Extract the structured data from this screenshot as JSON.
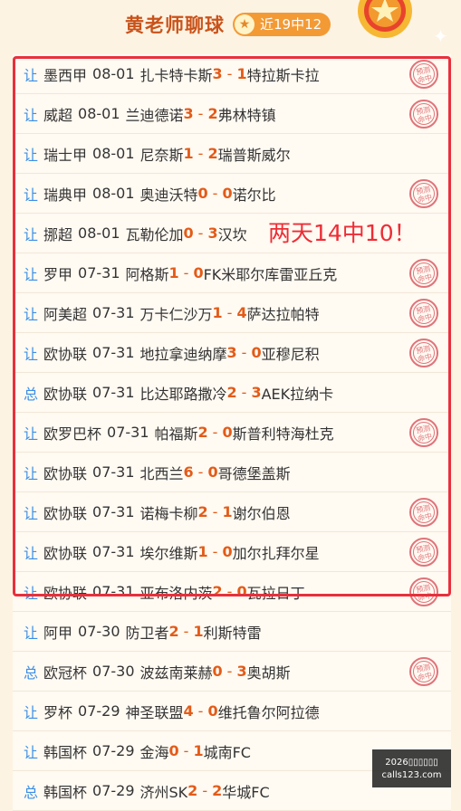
{
  "header": {
    "title": "黄老师聊球",
    "record": "近19中12"
  },
  "annotation": "两天14中10！",
  "stamp_text": "预测命中",
  "matches": [
    {
      "type": "让",
      "league": "墨西甲",
      "date": "08-01",
      "home": "扎卡特卡斯",
      "home_score": "3",
      "away_score": "1",
      "away": "特拉斯卡拉",
      "hit": true
    },
    {
      "type": "让",
      "league": "威超",
      "date": "08-01",
      "home": "兰迪德诺",
      "home_score": "3",
      "away_score": "2",
      "away": "弗林特镇",
      "hit": true
    },
    {
      "type": "让",
      "league": "瑞士甲",
      "date": "08-01",
      "home": "尼奈斯",
      "home_score": "1",
      "away_score": "2",
      "away": "瑞普斯威尔",
      "hit": false
    },
    {
      "type": "让",
      "league": "瑞典甲",
      "date": "08-01",
      "home": "奥迪沃特",
      "home_score": "0",
      "away_score": "0",
      "away": "诺尔比",
      "hit": true
    },
    {
      "type": "让",
      "league": "挪超",
      "date": "08-01",
      "home": "瓦勒伦加",
      "home_score": "0",
      "away_score": "3",
      "away": "汉坎",
      "hit": false
    },
    {
      "type": "让",
      "league": "罗甲",
      "date": "07-31",
      "home": "阿格斯",
      "home_score": "1",
      "away_score": "0",
      "away": "FK米耶尔库雷亚丘克",
      "hit": true
    },
    {
      "type": "让",
      "league": "阿美超",
      "date": "07-31",
      "home": "万卡仁沙万",
      "home_score": "1",
      "away_score": "4",
      "away": "萨达拉帕特",
      "hit": true
    },
    {
      "type": "让",
      "league": "欧协联",
      "date": "07-31",
      "home": "地拉拿迪纳摩",
      "home_score": "3",
      "away_score": "0",
      "away": "亚穆尼积",
      "hit": true
    },
    {
      "type": "总",
      "league": "欧协联",
      "date": "07-31",
      "home": "比达耶路撒冷",
      "home_score": "2",
      "away_score": "3",
      "away": "AEK拉纳卡",
      "hit": false
    },
    {
      "type": "让",
      "league": "欧罗巴杯",
      "date": "07-31",
      "home": "帕福斯",
      "home_score": "2",
      "away_score": "0",
      "away": "斯普利特海杜克",
      "hit": true
    },
    {
      "type": "让",
      "league": "欧协联",
      "date": "07-31",
      "home": "北西兰",
      "home_score": "6",
      "away_score": "0",
      "away": "哥德堡盖斯",
      "hit": false
    },
    {
      "type": "让",
      "league": "欧协联",
      "date": "07-31",
      "home": "诺梅卡柳",
      "home_score": "2",
      "away_score": "1",
      "away": "谢尔伯恩",
      "hit": true
    },
    {
      "type": "让",
      "league": "欧协联",
      "date": "07-31",
      "home": "埃尔维斯",
      "home_score": "1",
      "away_score": "0",
      "away": "加尔扎拜尔星",
      "hit": true
    },
    {
      "type": "让",
      "league": "欧协联",
      "date": "07-31",
      "home": "亚布洛内茨",
      "home_score": "2",
      "away_score": "0",
      "away": "瓦拉日丁",
      "hit": true
    },
    {
      "type": "让",
      "league": "阿甲",
      "date": "07-30",
      "home": "防卫者",
      "home_score": "2",
      "away_score": "1",
      "away": "利斯特雷",
      "hit": false
    },
    {
      "type": "总",
      "league": "欧冠杯",
      "date": "07-30",
      "home": "波兹南莱赫",
      "home_score": "0",
      "away_score": "3",
      "away": "奥胡斯",
      "hit": true
    },
    {
      "type": "让",
      "league": "罗杯",
      "date": "07-29",
      "home": "神圣联盟",
      "home_score": "4",
      "away_score": "0",
      "away": "维托鲁尔阿拉德",
      "hit": false
    },
    {
      "type": "让",
      "league": "韩国杯",
      "date": "07-29",
      "home": "金海",
      "home_score": "0",
      "away_score": "1",
      "away": "城南FC",
      "hit": false
    },
    {
      "type": "总",
      "league": "韩国杯",
      "date": "07-29",
      "home": "济州SK",
      "home_score": "2",
      "away_score": "2",
      "away": "华城FC",
      "hit": false
    }
  ],
  "watermark": {
    "line1": "2026▯▯▯▯▯▯",
    "line2": "calls123.com"
  }
}
